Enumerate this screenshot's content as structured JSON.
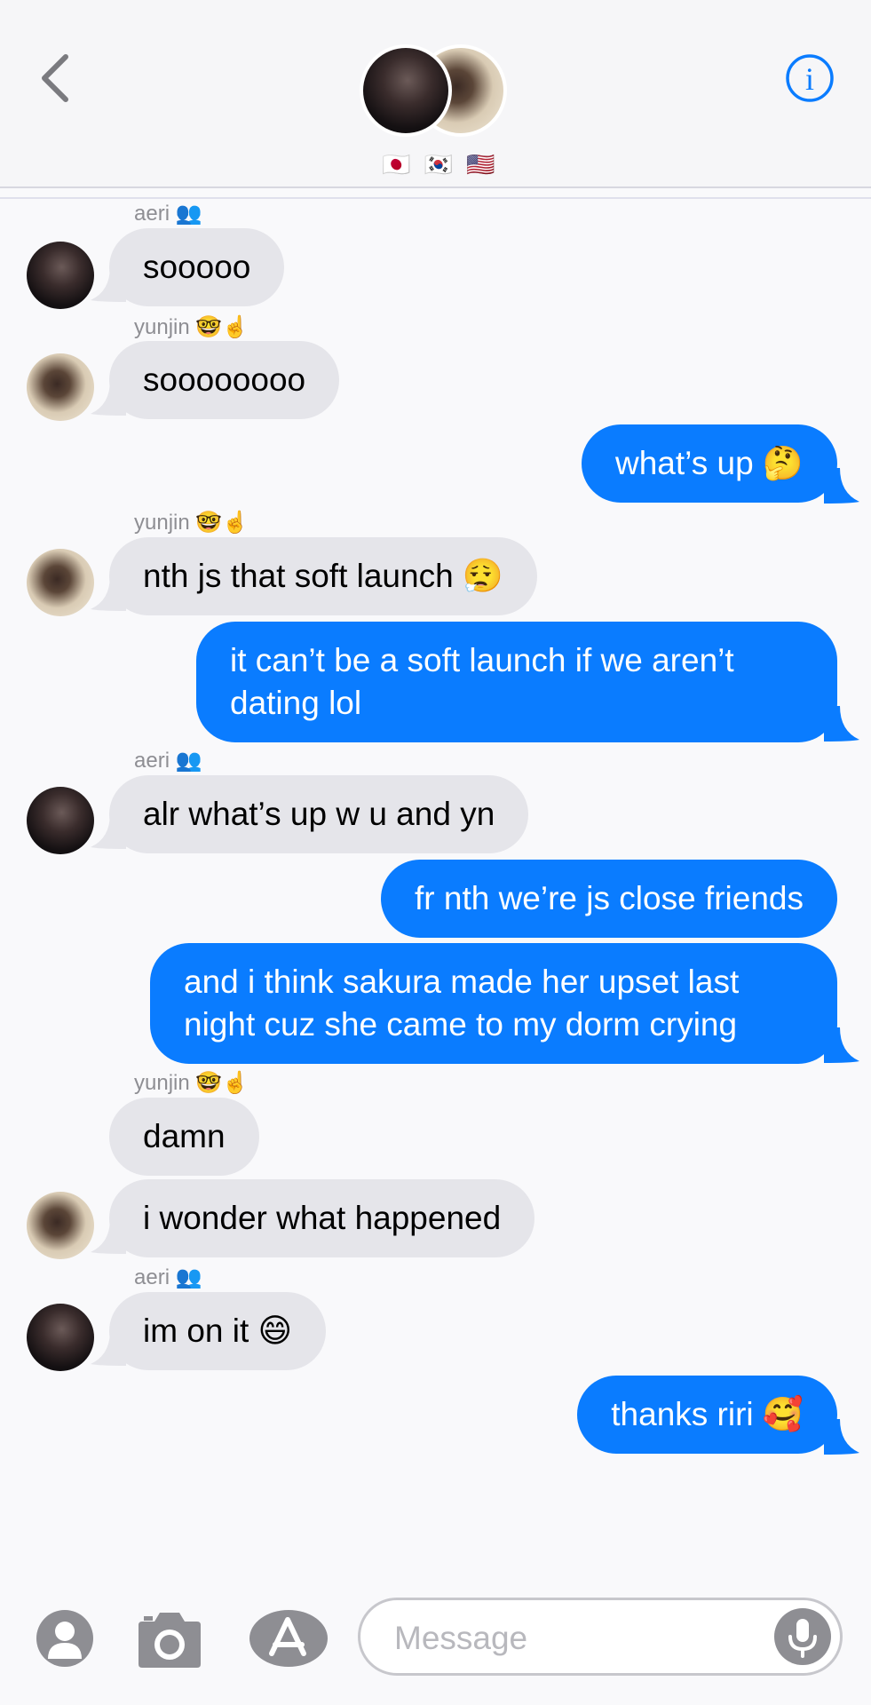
{
  "header": {
    "flags": "🇯🇵 🇰🇷 🇺🇸"
  },
  "messages": [
    {
      "sender": "aeri",
      "name_label": "aeri",
      "name_emoji": "👥",
      "text": "sooooo"
    },
    {
      "sender": "yunjin",
      "name_label": "yunjin",
      "name_emoji": "🤓☝️",
      "text": "soooooooo"
    },
    {
      "sender": "me",
      "text": "what’s up 🤔"
    },
    {
      "sender": "yunjin",
      "name_label": "yunjin",
      "name_emoji": "🤓☝️",
      "text": "nth js that soft launch 😮‍💨"
    },
    {
      "sender": "me",
      "text": "it can’t be a soft launch if we aren’t\ndating lol"
    },
    {
      "sender": "aeri",
      "name_label": "aeri",
      "name_emoji": "👥",
      "text": "alr what’s up w u and yn"
    },
    {
      "sender": "me",
      "text": "fr nth we’re js close friends"
    },
    {
      "sender": "me",
      "text": "and i think sakura made her upset last\nnight cuz she came to my dorm crying"
    },
    {
      "sender": "yunjin",
      "name_label": "yunjin",
      "name_emoji": "🤓☝️",
      "text": "damn"
    },
    {
      "sender": "yunjin",
      "text": "i wonder what happened"
    },
    {
      "sender": "aeri",
      "name_label": "aeri",
      "name_emoji": "👥",
      "text": "im on it 😄"
    },
    {
      "sender": "me",
      "text": "thanks riri 🥰"
    }
  ],
  "input": {
    "placeholder": "Message"
  },
  "colors": {
    "accent": "#0a7cff",
    "incoming_bubble": "#e5e5ea",
    "background": "#f9f9fb"
  },
  "icons": [
    "chevron-left-icon",
    "info-icon",
    "contact-icon",
    "camera-icon",
    "app-store-icon",
    "microphone-icon"
  ]
}
